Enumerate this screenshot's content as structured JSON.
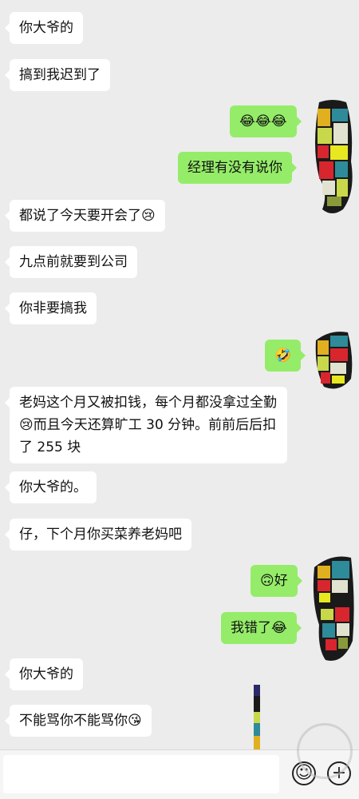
{
  "messages": [
    {
      "side": "left",
      "text": "你大爷的"
    },
    {
      "side": "left",
      "text": "搞到我迟到了"
    },
    {
      "side": "right",
      "text": "😂😂😂"
    },
    {
      "side": "right",
      "text": "经理有没有说你"
    },
    {
      "side": "left",
      "text": "都说了今天要开会了😢"
    },
    {
      "side": "left",
      "text": "九点前就要到公司"
    },
    {
      "side": "left",
      "text": "你非要搞我"
    },
    {
      "side": "right",
      "text": "🤣"
    },
    {
      "side": "left",
      "text_a": "老妈这个月又被扣钱，每个月都没拿过全勤",
      "emoji": "😢",
      "text_b": "而且今天还算旷工 30 分钟。前前后后扣了 255 块"
    },
    {
      "side": "left",
      "text": "你大爷的。"
    },
    {
      "side": "left",
      "text": "仔，下个月你买菜养老妈吧"
    },
    {
      "side": "right",
      "text": "🙃好"
    },
    {
      "side": "right",
      "text": "我错了😂"
    },
    {
      "side": "left",
      "text": "你大爷的"
    },
    {
      "side": "left",
      "text": "不能骂你不能骂你😘"
    }
  ],
  "input_bar": {
    "emoji_icon": "smiley-icon",
    "plus_icon": "plus-icon",
    "plus_glyph": "+",
    "emoji_glyph": "☺"
  },
  "colors": {
    "chat_bg": "#ececec",
    "left_bubble": "#ffffff",
    "right_bubble": "#95ec69"
  }
}
